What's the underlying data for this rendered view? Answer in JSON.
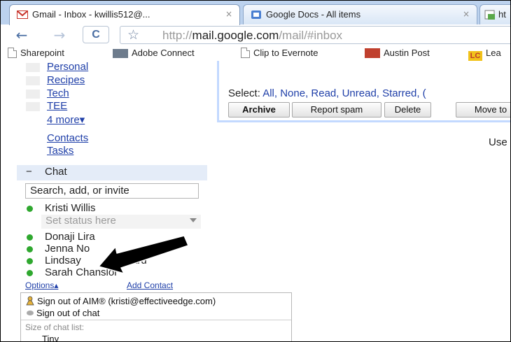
{
  "browser": {
    "tabs": [
      {
        "label": "Gmail - Inbox - kwillis512@...",
        "close": "×"
      },
      {
        "label": "Google Docs - All items",
        "close": "×"
      },
      {
        "label": "ht"
      }
    ],
    "nav": {
      "back": "←",
      "forward": "→",
      "reload": "C",
      "star": "☆"
    },
    "url": {
      "prefix": "http://",
      "host": "mail.google.com",
      "path": "/mail/#inbox"
    }
  },
  "bookmarks": [
    {
      "label": "Sharepoint",
      "icon": "page-icon"
    },
    {
      "label": "Adobe Connect",
      "icon": "adobe-connect-icon"
    },
    {
      "label": "Clip to Evernote",
      "icon": "page-icon"
    },
    {
      "label": "Austin Post",
      "icon": "austin-post-icon"
    },
    {
      "label": "Lea",
      "icon": "lc-icon",
      "icon_text": "LC"
    }
  ],
  "labels": {
    "items": [
      "Personal",
      "Recipes",
      "Tech",
      "TEE"
    ],
    "more": "4 more▾"
  },
  "nav_links": {
    "contacts": "Contacts",
    "tasks": "Tasks"
  },
  "chat": {
    "toggle": "−",
    "title": "Chat",
    "search_placeholder": "Search, add, or invite",
    "me": "Kristi Willis",
    "status_placeholder": "Set status here",
    "contacts": [
      "Donaji Lira",
      "Jenna No",
      "Lindsay",
      "ard",
      "Sarah Chanslor"
    ],
    "options": "Options▴",
    "add_contact": "Add Contact"
  },
  "menu": {
    "sign_out_aim": "Sign out of AIM® (kristi@effectiveedge.com)",
    "sign_out_chat": "Sign out of chat",
    "size_header": "Size of chat list:",
    "size_tiny": "Tiny"
  },
  "mail": {
    "select_label": "Select:",
    "select_options": "All, None, Read, Unread, Starred, (",
    "buttons": [
      "Archive",
      "Report spam",
      "Delete",
      "Move to"
    ],
    "use_text": "Use"
  },
  "colors": {
    "accent_blue": "#1f3fa8",
    "online_green": "#2fa82f",
    "chat_panel": "#e4ecf8",
    "arrow": "#000000"
  }
}
